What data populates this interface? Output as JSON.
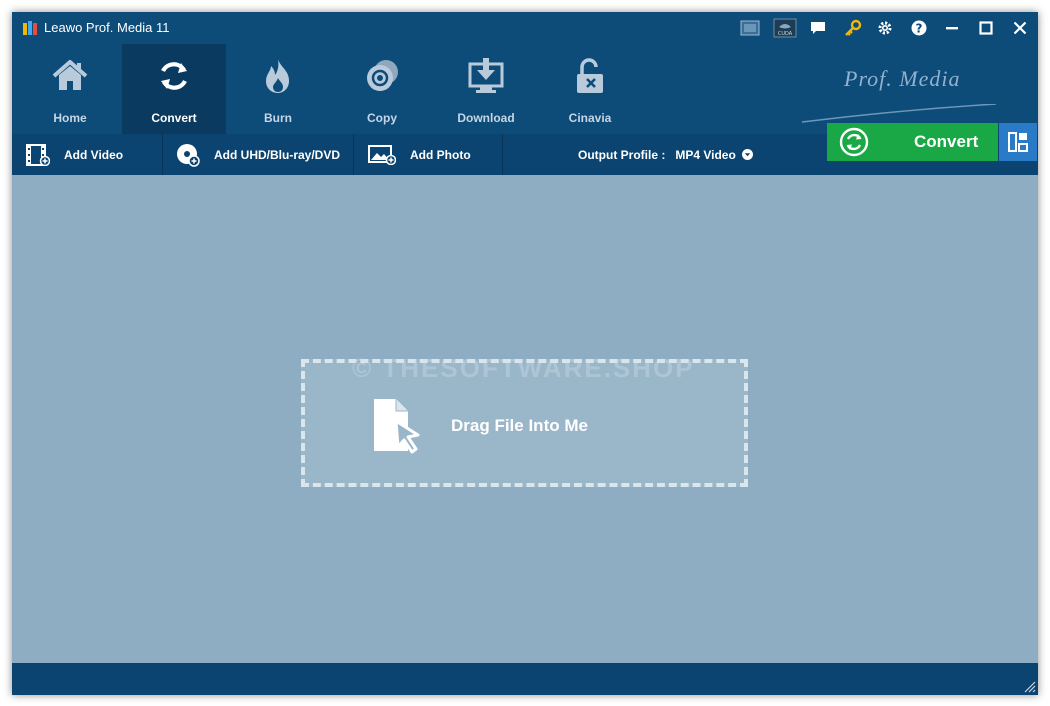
{
  "titlebar": {
    "title": "Leawo Prof. Media 11",
    "icons": [
      "screen-icon",
      "cuda-icon",
      "chat-icon",
      "key-icon",
      "gear-icon",
      "help-icon",
      "minimize-icon",
      "maximize-icon",
      "close-icon"
    ],
    "cuda_label": "CUDA"
  },
  "nav": {
    "items": [
      {
        "label": "Home",
        "icon": "home-icon"
      },
      {
        "label": "Convert",
        "icon": "refresh-icon",
        "active": true
      },
      {
        "label": "Burn",
        "icon": "flame-icon"
      },
      {
        "label": "Copy",
        "icon": "disc-copy-icon"
      },
      {
        "label": "Download",
        "icon": "download-icon"
      },
      {
        "label": "Cinavia",
        "icon": "unlock-icon"
      }
    ],
    "brand": "Prof. Media"
  },
  "toolbar": {
    "add_video": "Add Video",
    "add_disc": "Add UHD/Blu-ray/DVD",
    "add_photo": "Add Photo",
    "output_label": "Output Profile :",
    "output_value": "MP4 Video",
    "convert_label": "Convert"
  },
  "main": {
    "drop_text": "Drag File Into Me",
    "watermark": "© THESOFTWARE.SHOP"
  },
  "colors": {
    "title_bg": "#0d4b79",
    "nav_active": "#0a3a5f",
    "toolbar_bg": "#0b4470",
    "main_bg": "#8fadc2",
    "convert_green": "#1aa846",
    "layout_blue": "#2a7bc7"
  }
}
